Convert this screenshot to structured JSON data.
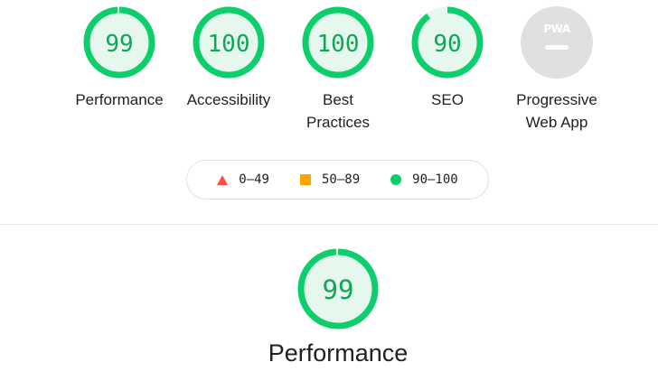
{
  "categories": [
    {
      "id": "perf",
      "score": 99,
      "label": "Performance"
    },
    {
      "id": "acc",
      "score": 100,
      "label": "Accessibility"
    },
    {
      "id": "bp",
      "score": 100,
      "label": "Best Practices"
    },
    {
      "id": "seo",
      "score": 90,
      "label": "SEO"
    },
    {
      "id": "pwa",
      "badge": "PWA",
      "label": "Progressive Web App"
    }
  ],
  "legend": [
    {
      "shape": "triangle",
      "range": "0–49",
      "color": "#ff4e42"
    },
    {
      "shape": "square",
      "range": "50–89",
      "color": "#ffa400"
    },
    {
      "shape": "circle",
      "range": "90–100",
      "color": "#0cce6b"
    }
  ],
  "detail": {
    "score": 99,
    "label": "Performance"
  },
  "colors": {
    "pass": "#0cce6b",
    "pass_text": "#008800",
    "pass_bg": "#e6f8ee",
    "neutral_bg": "#e0e0e0",
    "neutral_fg": "#ffffff",
    "text": "#212121"
  }
}
